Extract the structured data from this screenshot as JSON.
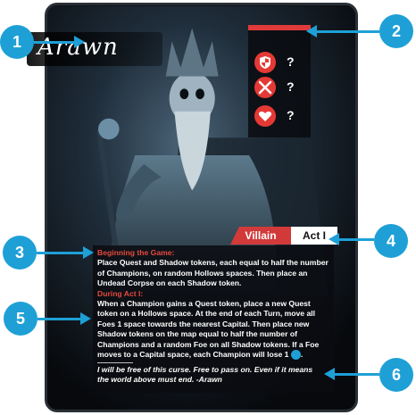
{
  "card": {
    "title": "Arawn",
    "stats": [
      {
        "icon": "shield-icon",
        "value": "?"
      },
      {
        "icon": "crossed-swords-icon",
        "value": "?"
      },
      {
        "icon": "heart-icon",
        "value": "?"
      }
    ],
    "tag_type": "Villain",
    "tag_act": "Act I",
    "rules": {
      "heading1": "Beginning the Game:",
      "text1": "Place Quest and Shadow tokens, each equal to half the number of Champions, on random Hollows spaces. Then place an Undead Corpse on each Shadow token.",
      "heading2": "During Act I:",
      "text2": "When a Champion gains a Quest token, place a new Quest token on a Hollows space. At the end of each Turn, move all Foes 1 space towards the nearest Capital. Then place new Shadow tokens on the map equal to half the number of Champions and a random Foe on all Shadow tokens. If a Foe moves to a Capital space, each Champion will lose 1",
      "text2_end": "."
    },
    "flavor": "I will be free of this curse. Free to pass on. Even if it means the world above must end. -Arawn"
  },
  "callouts": [
    "1",
    "2",
    "3",
    "4",
    "5",
    "6"
  ],
  "colors": {
    "accent_red": "#e03a3a",
    "callout_blue": "#1ea0d6"
  }
}
